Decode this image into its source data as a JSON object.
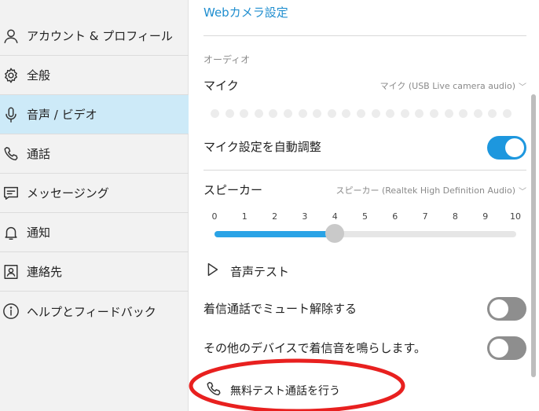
{
  "sidebar": {
    "items": [
      {
        "label": "アカウント & プロフィール",
        "icon": "user-icon",
        "active": false
      },
      {
        "label": "全般",
        "icon": "gear-icon",
        "active": false
      },
      {
        "label": "音声 / ビデオ",
        "icon": "microphone-icon",
        "active": true
      },
      {
        "label": "通話",
        "icon": "phone-icon",
        "active": false
      },
      {
        "label": "メッセージング",
        "icon": "message-icon",
        "active": false
      },
      {
        "label": "通知",
        "icon": "bell-icon",
        "active": false
      },
      {
        "label": "連絡先",
        "icon": "contact-card-icon",
        "active": false
      },
      {
        "label": "ヘルプとフィードバック",
        "icon": "info-icon",
        "active": false
      }
    ]
  },
  "main": {
    "webcam_link": "Webカメラ設定",
    "audio_section_title": "オーディオ",
    "mic": {
      "label": "マイク",
      "selected": "マイク (USB Live camera audio)"
    },
    "mic_auto_adjust": {
      "label": "マイク設定を自動調整",
      "on": true
    },
    "speaker": {
      "label": "スピーカー",
      "selected": "スピーカー (Realtek High Definition Audio)",
      "ticks": [
        "0",
        "1",
        "2",
        "3",
        "4",
        "5",
        "6",
        "7",
        "8",
        "9",
        "10"
      ],
      "volume": 4
    },
    "sound_test": "音声テスト",
    "unmute_incoming": {
      "label": "着信通話でミュート解除する",
      "on": false
    },
    "ring_other_devices": {
      "label": "その他のデバイスで着信音を鳴らします。",
      "on": false
    },
    "free_test_call": "無料テスト通話を行う"
  },
  "colors": {
    "accent": "#1d97de",
    "active_nav": "#cdeaf8",
    "annotation": "#e8201f"
  }
}
